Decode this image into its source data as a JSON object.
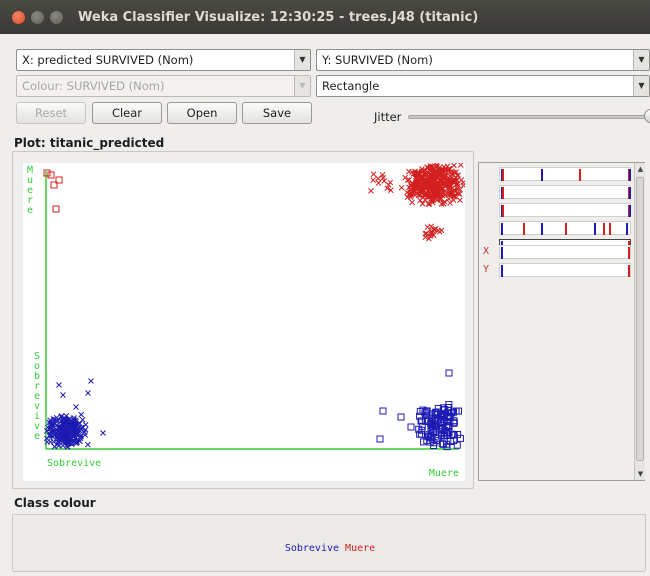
{
  "window": {
    "title": "Weka Classifier Visualize: 12:30:25 - trees.J48 (titanic)"
  },
  "controls": {
    "x_axis": "X: predicted SURVIVED (Nom)",
    "y_axis": "Y: SURVIVED (Nom)",
    "colour": "Colour: SURVIVED (Nom)",
    "shape": "Rectangle",
    "buttons": {
      "reset": "Reset",
      "clear": "Clear",
      "open": "Open",
      "save": "Save"
    },
    "jitter_label": "Jitter",
    "jitter_value": 1.0
  },
  "plot": {
    "title": "Plot: titanic_predicted",
    "x_axis_labels": {
      "low": "Sobrevive",
      "high": "Muere"
    },
    "y_axis_labels": {
      "low": "Sobrevive",
      "high": "Muere"
    },
    "colors": {
      "Sobrevive": "#1c1cb4",
      "Muere": "#d42020",
      "axis": "#33cc33"
    }
  },
  "attribute_panel": {
    "x_tag": "X",
    "y_tag": "Y"
  },
  "class_colour": {
    "title": "Class colour",
    "labels": [
      "Sobrevive",
      "Muere"
    ]
  }
}
